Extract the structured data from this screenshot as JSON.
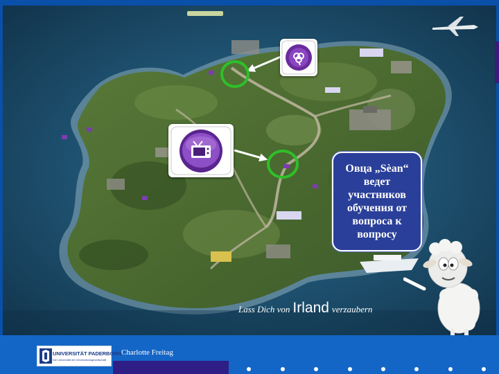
{
  "slide": {
    "map_caption_prefix": "Lass Dich von",
    "map_caption_brand": "Irland",
    "map_caption_suffix": "verzaubern",
    "speech_bubble": "Овца „Sèan“ ведет участников обучения от вопроса к вопросу",
    "shamrock_tile_icon": "shamrock-icon",
    "tv_tile_icon": "tv-icon",
    "highlight_color": "#2fbf2a"
  },
  "footer": {
    "logo_title": "UNIVERSITÄT PADERBORN",
    "logo_subtitle": "Die Universität der Informationsgesellschaft",
    "author": "Charlotte Freitag",
    "background_color": "#1466c6",
    "dot_count": 8
  }
}
